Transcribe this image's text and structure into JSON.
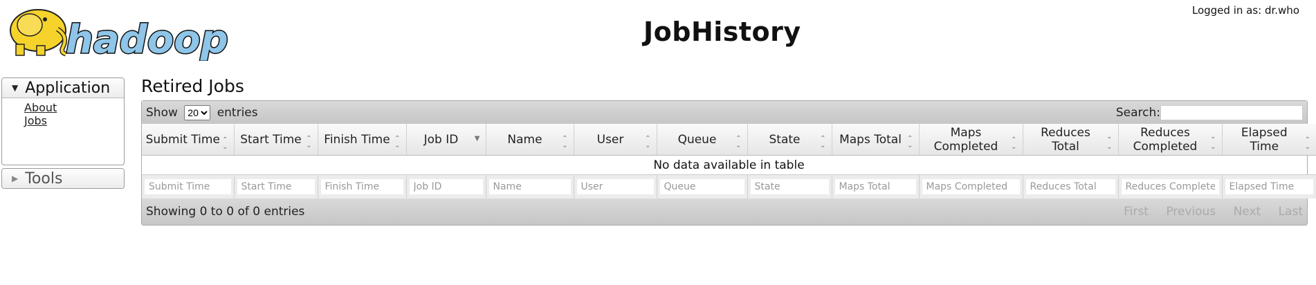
{
  "header": {
    "title": "JobHistory",
    "logged_in": "Logged in as: dr.who",
    "logo_text": "hadoop"
  },
  "nav": {
    "application": {
      "label": "Application",
      "links": [
        "About",
        "Jobs"
      ]
    },
    "tools": {
      "label": "Tools"
    }
  },
  "main": {
    "title": "Retired Jobs",
    "length": {
      "show": "Show",
      "value": "20",
      "entries": "entries"
    },
    "search": {
      "label": "Search:",
      "value": ""
    },
    "columns": [
      "Submit Time",
      "Start Time",
      "Finish Time",
      "Job ID",
      "Name",
      "User",
      "Queue",
      "State",
      "Maps Total",
      "Maps Completed",
      "Reduces Total",
      "Reduces Completed",
      "Elapsed Time"
    ],
    "filters": [
      "Submit Time",
      "Start Time",
      "Finish Time",
      "Job ID",
      "Name",
      "User",
      "Queue",
      "State",
      "Maps Total",
      "Maps Completed",
      "Reduces Total",
      "Reduces Completed",
      "Elapsed Time"
    ],
    "empty": "No data available in table",
    "info": "Showing 0 to 0 of 0 entries",
    "pager": [
      "First",
      "Previous",
      "Next",
      "Last"
    ]
  },
  "colors": {
    "logo_elephant": "#f6d32b",
    "logo_text": "#8ec5e8",
    "toolbar": "#cfcfcf"
  }
}
